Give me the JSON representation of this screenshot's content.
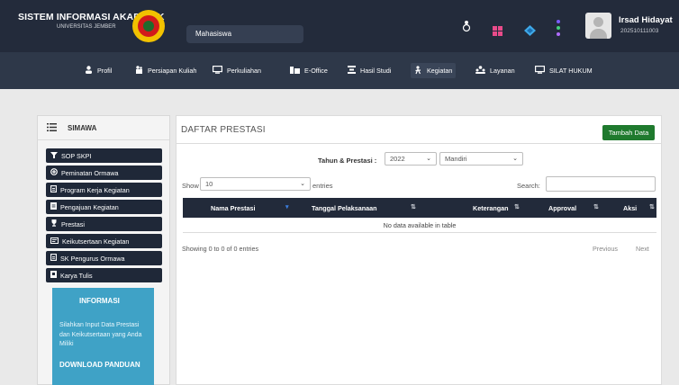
{
  "header": {
    "app_title": "SISTEM INFORMASI AKADEMIK",
    "app_subtitle": "UNIVERSITAS JEMBER",
    "role": "Mahasiswa",
    "user_name": "Irsad Hidayat",
    "user_id": "202510111003",
    "icons": [
      "map-pin-icon",
      "grid-icon",
      "diamond-icon",
      "dots-icon"
    ]
  },
  "nav": {
    "items": [
      {
        "label": "Profil",
        "icon": "user-icon"
      },
      {
        "label": "Persiapan Kuliah",
        "icon": "clipboard-icon"
      },
      {
        "label": "Perkuliahan",
        "icon": "screen-icon"
      },
      {
        "label": "E-Office",
        "icon": "office-icon"
      },
      {
        "label": "Hasil Studi",
        "icon": "chart-icon"
      },
      {
        "label": "Kegiatan",
        "icon": "activity-icon"
      },
      {
        "label": "Layanan",
        "icon": "people-icon"
      },
      {
        "label": "SILAT HUKUM",
        "icon": "screen-icon"
      }
    ],
    "active": "Kegiatan"
  },
  "sidebar": {
    "title": "SIMAWA",
    "items": [
      {
        "label": "SOP SKPI"
      },
      {
        "label": "Peminatan Ormawa"
      },
      {
        "label": "Program Kerja Kegiatan"
      },
      {
        "label": "Pengajuan Kegiatan"
      },
      {
        "label": "Prestasi"
      },
      {
        "label": "Keikutsertaan Kegiatan"
      },
      {
        "label": "SK Pengurus Ormawa"
      },
      {
        "label": "Karya Tulis"
      }
    ],
    "info": {
      "title": "INFORMASI",
      "text": "Silahkan Input Data Prestasi dan Keikutsertaan yang Anda Miliki",
      "download": "DOWNLOAD PANDUAN"
    }
  },
  "main": {
    "title": "DAFTAR PRESTASI",
    "add_button": "Tambah Data",
    "filter_label": "Tahun & Prestasi :",
    "year": "2022",
    "category": "Mandiri",
    "show_label": "Show",
    "page_length": "10",
    "entries_label": "entries",
    "search_label": "Search:",
    "columns": [
      "Nama Prestasi",
      "Tanggal Pelaksanaan",
      "Keterangan",
      "Approval",
      "Aksi"
    ],
    "empty_text": "No data available in table",
    "info_text": "Showing 0 to 0 of 0 entries",
    "prev": "Previous",
    "next": "Next"
  },
  "colors": {
    "header_bg": "#232b3b",
    "nav_bg": "#2e3849",
    "sidebar_button": "#1f2838",
    "info_box": "#3fa2c6",
    "add_button": "#1f7a2e"
  }
}
